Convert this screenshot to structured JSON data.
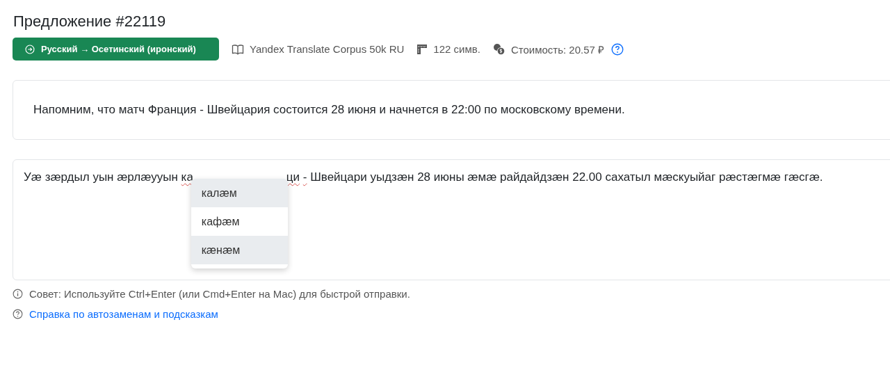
{
  "title": "Предложение #22119",
  "language_badge": {
    "label": "Русский → Осетинский (иронский)"
  },
  "meta": [
    {
      "kind": "corpus",
      "text": "Yandex Translate Corpus 50k RU"
    },
    {
      "kind": "length",
      "text": "122 симв."
    },
    {
      "kind": "cost",
      "text": "Стоимость: 20.57 ₽"
    }
  ],
  "source": {
    "text": "Напомним, что матч Франция - Швейцария состоится 28 июня и начнется в 22:00 по московскому времени."
  },
  "translation": {
    "before": [
      {
        "text": "Уæ зæрдыл уын æрлæууын",
        "misspelled": false
      },
      {
        "text": "ка",
        "misspelled": true
      }
    ],
    "after": [
      {
        "text": "ци",
        "misspelled": true
      },
      {
        "text": "-",
        "misspelled": true
      },
      {
        "text": "Швейцари уыдзæн 28 июны æмæ райдайдзæн 22.00 сахатыл мæскуыйаг рæстæгмæ гæсгæ.",
        "misspelled": false
      }
    ],
    "suggestions": [
      {
        "text": "калæм",
        "highlighted": true
      },
      {
        "text": "кафæм",
        "highlighted": false
      },
      {
        "text": "кæнæм",
        "highlighted": true
      }
    ]
  },
  "tip": "Совет: Используйте Ctrl+Enter (или Cmd+Enter на Mac) для быстрой отправки.",
  "help_link": "Справка по автозаменам и подсказкам"
}
